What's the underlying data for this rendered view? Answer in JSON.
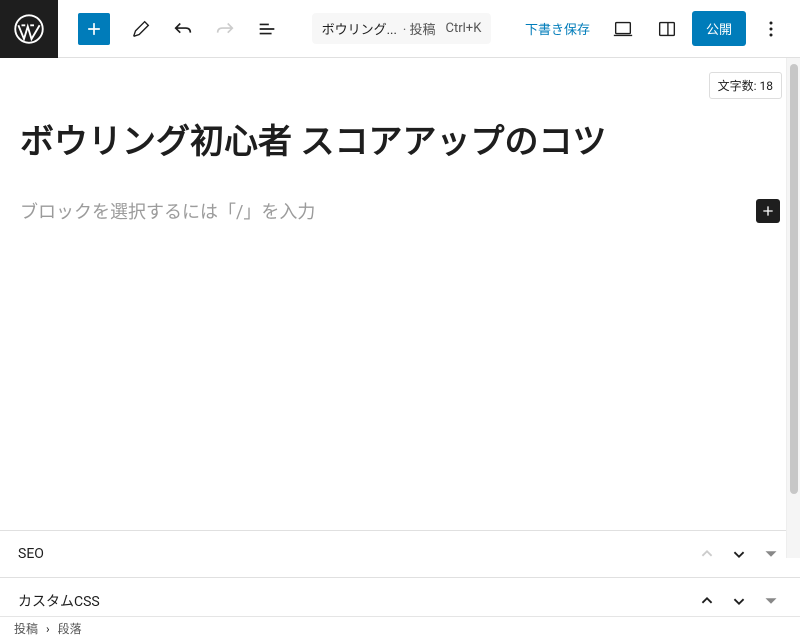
{
  "toolbar": {
    "doc_title": "ボウリング...",
    "doc_type": "投稿",
    "doc_shortcut": "Ctrl+K",
    "save_draft_label": "下書き保存",
    "publish_label": "公開"
  },
  "editor": {
    "word_count_label": "文字数:",
    "word_count_value": "18",
    "post_title": "ボウリング初心者 スコアアップのコツ",
    "block_placeholder": "ブロックを選択するには「/」を入力"
  },
  "panels": {
    "seo_label": "SEO",
    "custom_css_label": "カスタムCSS"
  },
  "breadcrumb": {
    "root": "投稿",
    "separator": "›",
    "current": "段落"
  }
}
